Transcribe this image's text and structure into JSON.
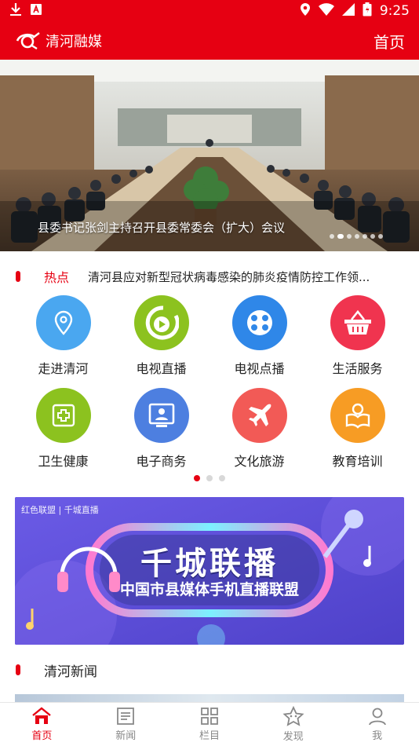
{
  "statusbar": {
    "time": "9:25"
  },
  "appbar": {
    "brand": "清河融媒",
    "home": "首页"
  },
  "banner": {
    "caption": "县委书记张剑主持召开县委常委会（扩大）会议",
    "slides": 7,
    "active_slide": 1
  },
  "hot": {
    "tag": "热点",
    "text": "清河县应对新型冠状病毒感染的肺炎疫情防控工作领..."
  },
  "services": [
    {
      "label": "走进清河",
      "icon": "location-pin-icon",
      "color": "#4aa7f0"
    },
    {
      "label": "电视直播",
      "icon": "tv-live-icon",
      "color": "#8cc21f"
    },
    {
      "label": "电视点播",
      "icon": "film-reel-icon",
      "color": "#2f87e8"
    },
    {
      "label": "生活服务",
      "icon": "shopping-basket-icon",
      "color": "#f0344f"
    },
    {
      "label": "卫生健康",
      "icon": "medical-cross-icon",
      "color": "#8cc21f"
    },
    {
      "label": "电子商务",
      "icon": "monitor-user-icon",
      "color": "#4d7fe0"
    },
    {
      "label": "文化旅游",
      "icon": "airplane-icon",
      "color": "#f25a56"
    },
    {
      "label": "教育培训",
      "icon": "reading-icon",
      "color": "#f79c24"
    }
  ],
  "pager": {
    "pages": 3,
    "active": 0
  },
  "promo": {
    "tag": "红色联盟 | 千城直播",
    "title": "千城联播",
    "subtitle": "中国市县媒体手机直播联盟"
  },
  "section": {
    "title": "清河新闻"
  },
  "tabs": [
    {
      "label": "首页",
      "icon": "home-icon",
      "active": true
    },
    {
      "label": "新闻",
      "icon": "newspaper-icon",
      "active": false
    },
    {
      "label": "栏目",
      "icon": "grid-icon",
      "active": false
    },
    {
      "label": "发现",
      "icon": "discover-star-icon",
      "active": false
    },
    {
      "label": "我",
      "icon": "profile-icon",
      "active": false
    }
  ],
  "colors": {
    "brand_red": "#e60012"
  }
}
